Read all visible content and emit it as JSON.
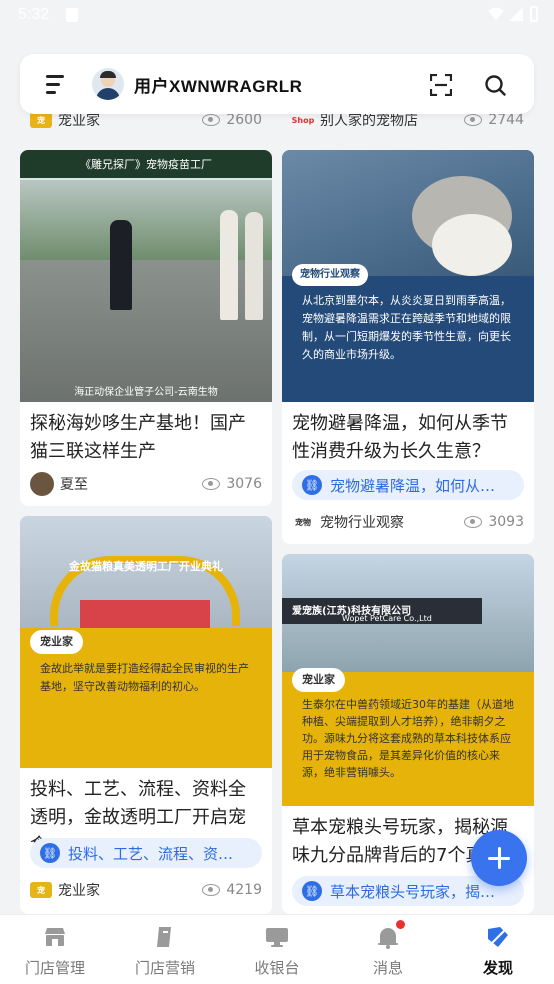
{
  "status_bar": {
    "time": "5:32"
  },
  "header": {
    "username": "用户XWNWRAGRLR"
  },
  "feed": {
    "top_row": {
      "left": {
        "author": "宠业家",
        "views": "2600"
      },
      "right": {
        "author": "别人家的宠物店",
        "views": "2744"
      }
    },
    "left_cards": [
      {
        "image_caption_top": "《雕兄探厂》宠物疫苗工厂",
        "image_caption_bottom": "海正动保企业管子公司-云南生物",
        "title": "探秘海妙哆生产基地！国产猫三联这样生产",
        "author": "夏至",
        "views": "3076"
      },
      {
        "image_banner": "金故猫粮真美透明工厂开业典礼",
        "image_brand": "宠业家",
        "image_text": "金故此举就是要打造经得起全民审视的生产基地，坚守改善动物福利的初心。",
        "title": "投料、工艺、流程、资料全透明，金故透明工厂开启宠食\"…",
        "tag": "投料、工艺、流程、资…",
        "author": "宠业家",
        "views": "4219"
      }
    ],
    "right_cards": [
      {
        "image_brand": "宠物行业观察",
        "image_text": "从北京到墨尔本，从炎炎夏日到雨季高温，宠物避暑降温需求正在跨越季节和地域的限制，从一门短期爆发的季节性生意，向更长久的商业市场升级。",
        "title": "宠物避暑降温，如何从季节性消费升级为长久生意？",
        "tag": "宠物避暑降温，如何从…",
        "author": "宠物行业观察",
        "views": "3093"
      },
      {
        "image_sign": "爱宠族(江苏)科技有限公司",
        "image_sign_en": "Wopet PetCare Co.,Ltd",
        "image_brand": "宠业家",
        "image_text": "生泰尔在中兽药领域近30年的基建（从道地种植、尖端提取到人才培养），绝非朝夕之功。源味九分将这套成熟的草本科技体系应用于宠物食品，是其差异化价值的核心来源，绝非营销噱头。",
        "title": "草本宠粮头号玩家，揭秘源味九分品牌背后的7个真相",
        "tag": "草本宠粮头号玩家，揭…"
      }
    ]
  },
  "tabbar": {
    "tabs": [
      {
        "label": "门店管理"
      },
      {
        "label": "门店营销"
      },
      {
        "label": "收银台"
      },
      {
        "label": "消息"
      },
      {
        "label": "发现"
      }
    ]
  },
  "colors": {
    "accent": "#3a73ee",
    "tag_bg": "#e9f0fd",
    "yellow": "#e5b30a",
    "navy": "#234a78"
  }
}
